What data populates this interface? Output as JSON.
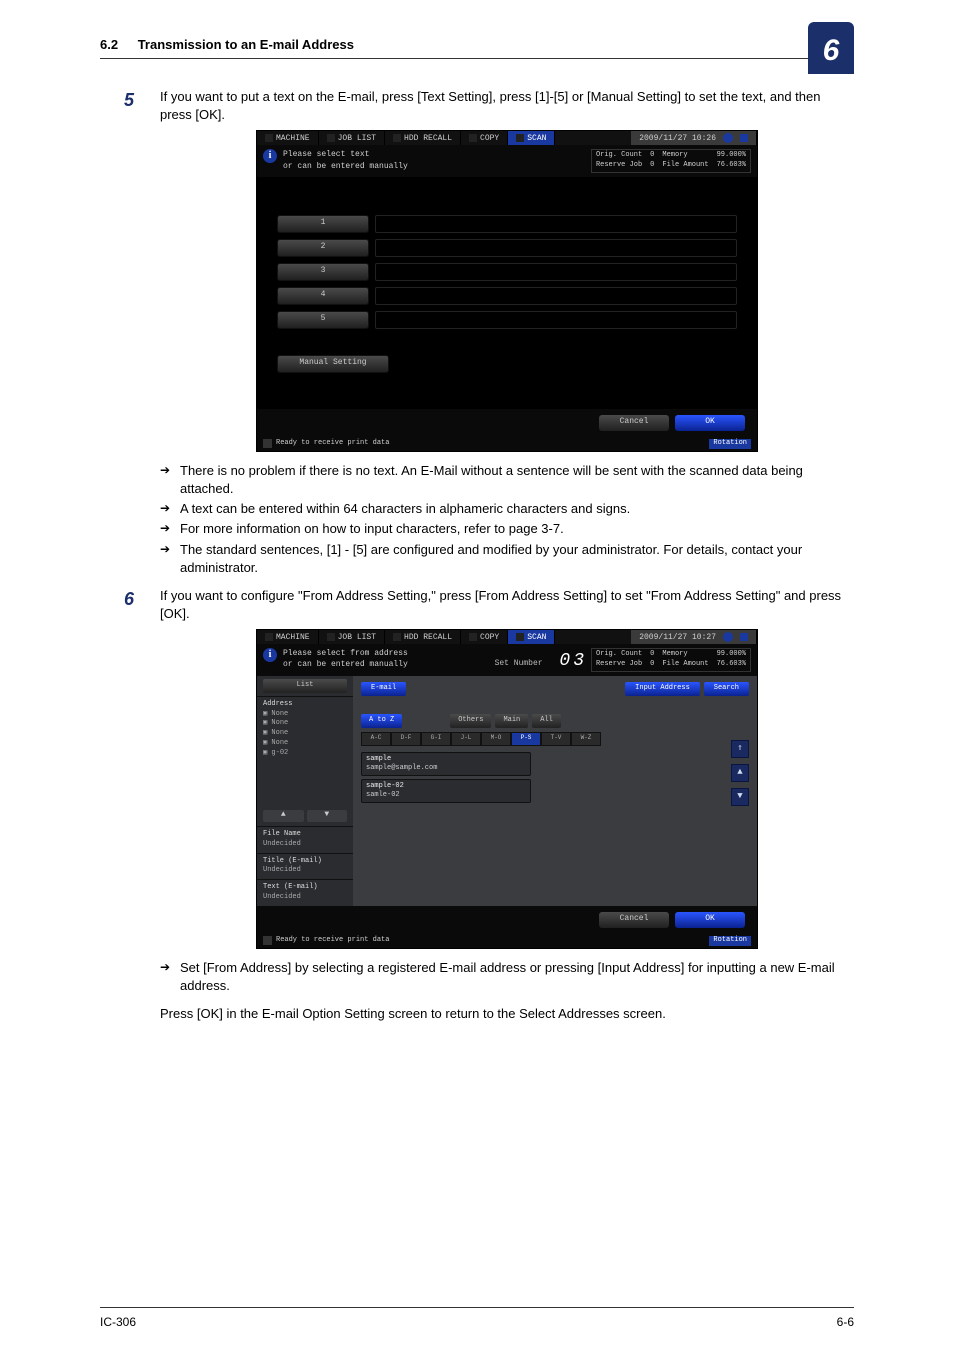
{
  "header": {
    "section": "6.2",
    "title": "Transmission to an E-mail Address",
    "chapter": "6"
  },
  "step5": {
    "num": "5",
    "text": "If you want to put a text on the E-mail, press  [Text Setting], press [1]-[5] or [Manual Setting] to set the text, and then press [OK].",
    "notes": [
      "There is no problem if there is no text. An E-Mail without a sentence will be sent with the scanned data being attached.",
      "A text can be entered within 64 characters in alphameric characters and signs.",
      "For more information on how to input characters, refer to page 3-7.",
      "The standard sentences, [1] - [5] are configured and modified by your administrator.  For details, contact your administrator."
    ]
  },
  "step6": {
    "num": "6",
    "text": "If you want to configure \"From Address Setting,\" press [From Address Setting] to set \"From Address Setting\" and press [OK].",
    "notes": [
      "Set [From Address] by selecting a registered  E-mail address or pressing [Input Address] for inputting a new E-mail address."
    ],
    "after": "Press [OK] in the E-mail Option Setting screen to return to the Select Addresses screen."
  },
  "footer": {
    "left": "IC-306",
    "right": "6-6"
  },
  "shot1": {
    "tabs": {
      "machine": "MACHINE",
      "joblist": "JOB LIST",
      "hddrecall": "HDD RECALL",
      "copy": "COPY",
      "scan": "SCAN",
      "time": "2009/11/27 10:26"
    },
    "info_line1": "Please select text",
    "info_line2": "or can be entered manually",
    "status": {
      "orig_count_label": "Orig. Count",
      "orig_count_val": "0",
      "memory_label": "Memory",
      "memory_val": "99.000%",
      "reserve_label": "Reserve Job",
      "reserve_val": "0",
      "file_label": "File Amount",
      "file_val": "76.603%"
    },
    "slots": [
      "1",
      "2",
      "3",
      "4",
      "5"
    ],
    "manual": "Manual Setting",
    "cancel": "Cancel",
    "ok": "OK",
    "foot_status": "Ready to receive print data",
    "foot_rot": "Rotation"
  },
  "shot2": {
    "tabs": {
      "machine": "MACHINE",
      "joblist": "JOB LIST",
      "hddrecall": "HDD RECALL",
      "copy": "COPY",
      "scan": "SCAN",
      "time": "2009/11/27 10:27"
    },
    "info_line1": "Please select from address",
    "info_line2": "or can be entered manually",
    "setnum_label": "Set Number",
    "setnum_val": "03",
    "status": {
      "orig_count_label": "Orig. Count",
      "orig_count_val": "0",
      "memory_label": "Memory",
      "memory_val": "99.000%",
      "reserve_label": "Reserve Job",
      "reserve_val": "0",
      "file_label": "File Amount",
      "file_val": "76.603%"
    },
    "sidebar": {
      "list_btn": "List",
      "address_label": "Address",
      "none": "None",
      "g02": "g-02",
      "filename_label": "File Name",
      "filename_val": "Undecided",
      "title_label": "Title (E-mail)",
      "title_val": "Undecided",
      "text_label": "Text (E-mail)",
      "text_val": "Undecided"
    },
    "main": {
      "email_tab": "E-mail",
      "input_address": "Input Address",
      "search": "Search",
      "filters": {
        "atoz": "A to Z",
        "others": "Others",
        "main": "Main",
        "all": "All"
      },
      "letters": [
        "A-C",
        "D-F",
        "G-I",
        "J-L",
        "M-O",
        "P-S",
        "T-V",
        "W-Z"
      ],
      "entries": [
        {
          "name": "sample",
          "addr": "sample@sample.com"
        },
        {
          "name": "sample-02",
          "addr": "samle-02"
        }
      ]
    },
    "cancel": "Cancel",
    "ok": "OK",
    "foot_status": "Ready to receive print data",
    "foot_rot": "Rotation"
  }
}
